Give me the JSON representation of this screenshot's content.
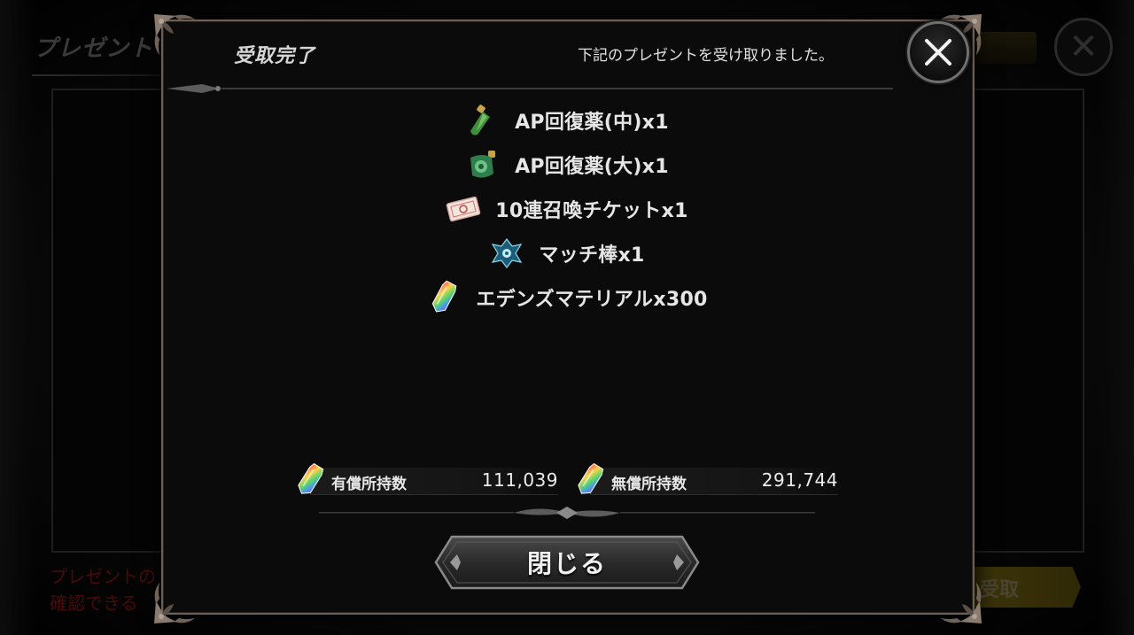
{
  "background": {
    "title": "プレゼント",
    "notice_lines": [
      "プレゼントの",
      "確認できる"
    ],
    "receive_button_label": "受取"
  },
  "dialog": {
    "title": "受取完了",
    "message": "下記のプレゼントを受け取りました。",
    "items": [
      {
        "label": "AP回復薬(中)x1",
        "icon": "green-potion-bottle-icon"
      },
      {
        "label": "AP回復薬(大)x1",
        "icon": "green-large-potion-icon"
      },
      {
        "label": "10連召喚チケットx1",
        "icon": "summon-ticket-icon"
      },
      {
        "label": "マッチ棒x1",
        "icon": "match-stick-crest-icon"
      },
      {
        "label": "エデンズマテリアルx300",
        "icon": "rainbow-crystal-icon"
      }
    ],
    "currency": {
      "paid": {
        "label": "有償所持数",
        "value": "111,039",
        "icon": "rainbow-crystal-icon"
      },
      "free": {
        "label": "無償所持数",
        "value": "291,744",
        "icon": "rainbow-crystal-icon"
      }
    },
    "close_button_label": "閉じる"
  },
  "colors": {
    "frame": "#6c5f55",
    "text": "#e6e6e6",
    "dialog_bg": "#0b0b0b",
    "background_notice": "#4a0a0a"
  }
}
